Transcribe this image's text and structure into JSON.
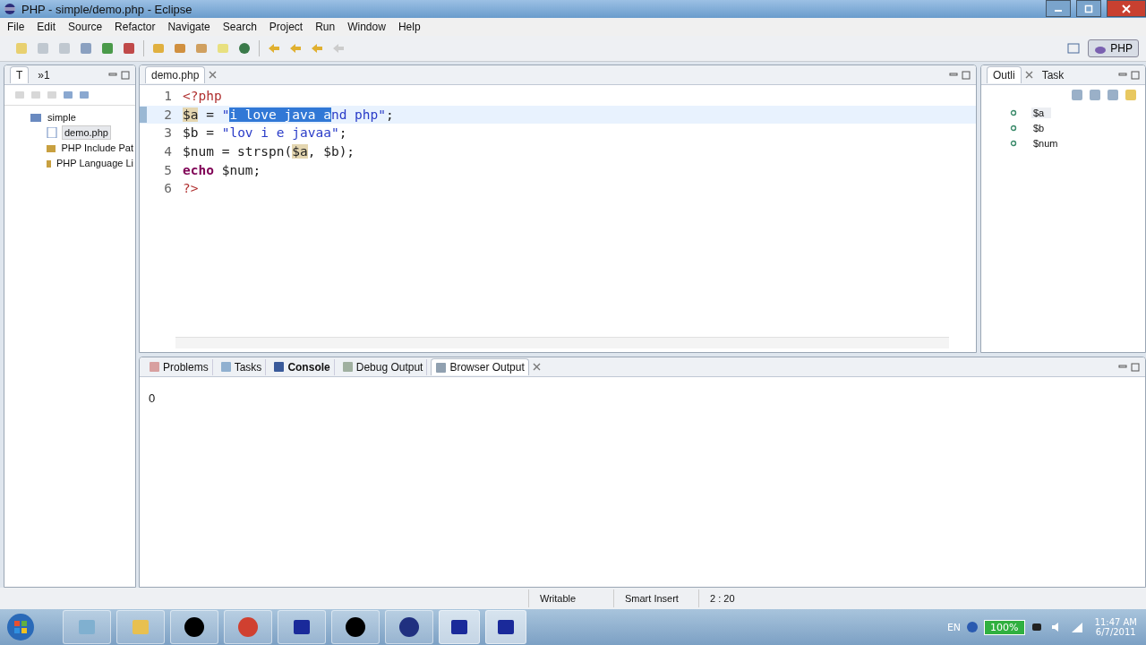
{
  "window": {
    "title": "PHP - simple/demo.php - Eclipse"
  },
  "menu": [
    "File",
    "Edit",
    "Source",
    "Refactor",
    "Navigate",
    "Search",
    "Project",
    "Run",
    "Window",
    "Help"
  ],
  "perspective": {
    "label": "PHP",
    "selected": true
  },
  "explorer": {
    "tabs": [
      {
        "label": "T",
        "selected": true
      },
      {
        "label": "»1",
        "selected": false
      }
    ],
    "tree": [
      {
        "label": "simple",
        "kind": "project",
        "selected": false,
        "children": [
          {
            "label": "demo.php",
            "kind": "file",
            "selected": true
          },
          {
            "label": "PHP Include Pat",
            "kind": "library",
            "selected": false
          },
          {
            "label": "PHP Language Li",
            "kind": "library",
            "selected": false
          }
        ]
      }
    ]
  },
  "editor": {
    "tab": {
      "label": "demo.php",
      "selected": true
    },
    "lines": [
      {
        "number": "1",
        "current": false,
        "tokens": [
          {
            "text": "<?php",
            "kind": "tag",
            "selected": false,
            "occurrence": false
          }
        ]
      },
      {
        "number": "2",
        "current": true,
        "tokens": [
          {
            "text": "$a",
            "kind": "var",
            "selected": false,
            "occurrence": true
          },
          {
            "text": " = ",
            "kind": "plain",
            "selected": false,
            "occurrence": false
          },
          {
            "text": "\"",
            "kind": "string",
            "selected": false,
            "occurrence": false
          },
          {
            "text": "i love java a",
            "kind": "string",
            "selected": true,
            "occurrence": false
          },
          {
            "text": "nd php\"",
            "kind": "string",
            "selected": false,
            "occurrence": false
          },
          {
            "text": ";",
            "kind": "plain",
            "selected": false,
            "occurrence": false
          }
        ]
      },
      {
        "number": "3",
        "current": false,
        "tokens": [
          {
            "text": "$b",
            "kind": "var",
            "selected": false,
            "occurrence": false
          },
          {
            "text": " = ",
            "kind": "plain",
            "selected": false,
            "occurrence": false
          },
          {
            "text": "\"lov i e javaa\"",
            "kind": "string",
            "selected": false,
            "occurrence": false
          },
          {
            "text": ";",
            "kind": "plain",
            "selected": false,
            "occurrence": false
          }
        ]
      },
      {
        "number": "4",
        "current": false,
        "tokens": [
          {
            "text": "$num",
            "kind": "var",
            "selected": false,
            "occurrence": false
          },
          {
            "text": " = strspn(",
            "kind": "plain",
            "selected": false,
            "occurrence": false
          },
          {
            "text": "$a",
            "kind": "var",
            "selected": false,
            "occurrence": true
          },
          {
            "text": ", ",
            "kind": "plain",
            "selected": false,
            "occurrence": false
          },
          {
            "text": "$b",
            "kind": "var",
            "selected": false,
            "occurrence": false
          },
          {
            "text": ");",
            "kind": "plain",
            "selected": false,
            "occurrence": false
          }
        ]
      },
      {
        "number": "5",
        "current": false,
        "tokens": [
          {
            "text": "echo",
            "kind": "keyword",
            "selected": false,
            "occurrence": false
          },
          {
            "text": " $num;",
            "kind": "plain",
            "selected": false,
            "occurrence": false
          }
        ]
      },
      {
        "number": "6",
        "current": false,
        "tokens": [
          {
            "text": "?>",
            "kind": "tag",
            "selected": false,
            "occurrence": false
          }
        ]
      }
    ]
  },
  "outline": {
    "tabs": [
      {
        "label": "Outli",
        "selected": true,
        "closable": true
      },
      {
        "label": "Task",
        "selected": false,
        "closable": false
      }
    ],
    "items": [
      {
        "label": "$a",
        "selected": true
      },
      {
        "label": "$b",
        "selected": false
      },
      {
        "label": "$num",
        "selected": false
      }
    ]
  },
  "bottom": {
    "tabs": [
      {
        "label": "Problems",
        "selected": false,
        "bold": false
      },
      {
        "label": "Tasks",
        "selected": false,
        "bold": false
      },
      {
        "label": "Console",
        "selected": false,
        "bold": true
      },
      {
        "label": "Debug Output",
        "selected": false,
        "bold": false
      },
      {
        "label": "Browser Output",
        "selected": true,
        "bold": false
      }
    ],
    "output": "0"
  },
  "status_bar": [
    "Writable",
    "Smart Insert",
    "2 : 20"
  ],
  "tray": {
    "language": "EN",
    "battery": "100%",
    "time": "11:47 AM",
    "date": "6/7/2011"
  }
}
